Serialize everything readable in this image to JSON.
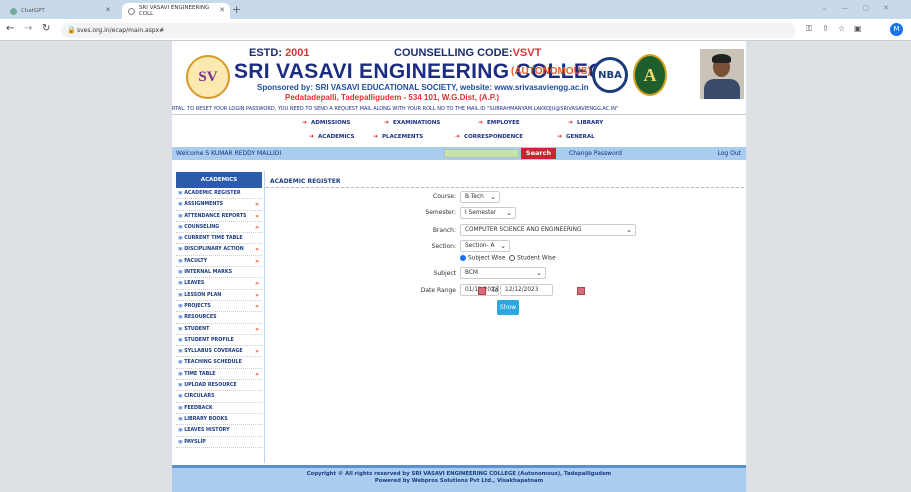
{
  "browser": {
    "tabs": [
      {
        "label": "ChatGPT",
        "active": false
      },
      {
        "label": "SRI VASAVI ENGINEERING COLL",
        "active": true
      }
    ],
    "url": "sves.org.in/ecap/main.aspx#",
    "profile_initial": "M"
  },
  "header": {
    "estd_label": "ESTD:",
    "estd_year": "2001",
    "counselling_label": "COUNSELLING CODE:",
    "counselling_code": "VSVT",
    "college_name": "SRI VASAVI ENGINEERING COLLEGE",
    "autonomous": "(AUTONOMOUS)",
    "sponsor_prefix": "Sponsored by:",
    "sponsor_text": "SRI VASAVI EDUCATIONAL SOCIETY, website: www.srivasaviengg.ac.in",
    "address": "Pedatadepalli, Tadepalligudem - 534 101, W.G.Dist, (A.P.)",
    "logo_text": "SV",
    "nba_text": "NBA",
    "naac_text": "A"
  },
  "marquee": "RTAL. TO RESET YOUR LOGIN PASSWORD, YOU NEED TO SEND A REQUEST MAIL ALONG WITH YOUR ROLL NO TO THE MAIL ID \"SUBRAHMANYAM.LAKKOJU@SRIVASAVIENGG.AC.IN\"",
  "top_menu": {
    "row1": [
      "ADMISSIONS",
      "EXAMINATIONS",
      "EMPLOYEE",
      "LIBRARY"
    ],
    "row2": [
      "ACADEMICS",
      "PLACEMENTS",
      "CORRESPONDENCE",
      "GENERAL"
    ]
  },
  "welcome_bar": {
    "welcome": "Welcome S KUMAR REDDY MALLIDI",
    "search_button": "Search",
    "change_password": "Change Password",
    "logout": "Log Out"
  },
  "sidebar": {
    "heading": "ACADEMICS",
    "items": [
      {
        "label": "ACADEMIC REGISTER",
        "arrow": false
      },
      {
        "label": "ASSIGNMENTS",
        "arrow": true
      },
      {
        "label": "ATTENDANCE REPORTS",
        "arrow": true
      },
      {
        "label": "COUNSELING",
        "arrow": true
      },
      {
        "label": "CURRENT TIME TABLE",
        "arrow": false
      },
      {
        "label": "DISCIPLINARY ACTION",
        "arrow": true
      },
      {
        "label": "FACULTY",
        "arrow": true
      },
      {
        "label": "INTERNAL MARKS",
        "arrow": false
      },
      {
        "label": "LEAVES",
        "arrow": true
      },
      {
        "label": "LESSON PLAN",
        "arrow": true
      },
      {
        "label": "PROJECTS",
        "arrow": true
      },
      {
        "label": "RESOURCES",
        "arrow": false
      },
      {
        "label": "STUDENT",
        "arrow": true
      },
      {
        "label": "STUDENT PROFILE",
        "arrow": false
      },
      {
        "label": "SYLLABUS COVERAGE",
        "arrow": true
      },
      {
        "label": "TEACHING SCHEDULE",
        "arrow": false
      },
      {
        "label": "TIME TABLE",
        "arrow": true
      },
      {
        "label": "UPLOAD RESOURCE",
        "arrow": false
      },
      {
        "label": "CIRCULARS",
        "arrow": false
      },
      {
        "label": "FEEDBACK",
        "arrow": false
      },
      {
        "label": "LIBRARY BOOKS",
        "arrow": false
      },
      {
        "label": "LEAVES HISTORY",
        "arrow": false
      },
      {
        "label": "PAYSLIP",
        "arrow": false
      }
    ]
  },
  "form": {
    "title": "ACADEMIC REGISTER",
    "course_label": "Course:",
    "course_value": "B.Tech",
    "semester_label": "Semester:",
    "semester_value": "I Semester",
    "branch_label": "Branch:",
    "branch_value": "COMPUTER SCIENCE AND ENGINEERING",
    "section_label": "Section:",
    "section_value": "Section- A",
    "radio_subject": "Subject Wise",
    "radio_student": "Student Wise",
    "subject_label": "Subject",
    "subject_value": "BCM",
    "date_label": "Date Range",
    "date_from": "01/12/2023",
    "date_to_label": "To",
    "date_to": "12/12/2023",
    "show_button": "Show"
  },
  "footer": {
    "line1": "Copyright © All rights reserved by SRI VASAVI ENGINEERING COLLEGE (Autonomous), Tadepalligudem",
    "line2": "Powered by Webpros Solutions Pvt Ltd., Visakhapatnam"
  }
}
